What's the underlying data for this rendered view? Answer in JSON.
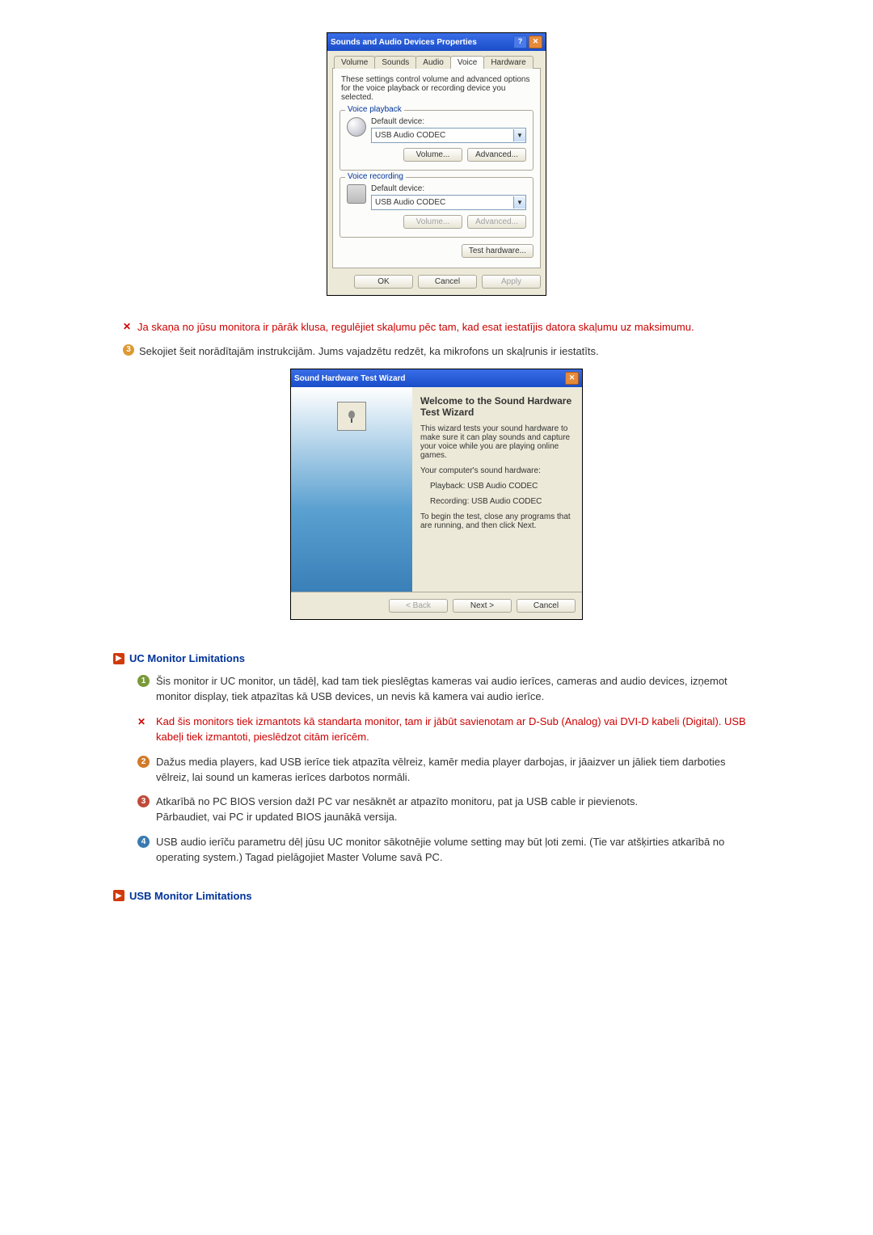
{
  "dialog1": {
    "title": "Sounds and Audio Devices Properties",
    "tabs": [
      "Volume",
      "Sounds",
      "Audio",
      "Voice",
      "Hardware"
    ],
    "active_tab": "Voice",
    "description": "These settings control volume and advanced options for the voice playback or recording device you selected.",
    "playback": {
      "group_label": "Voice playback",
      "label": "Default device:",
      "value": "USB Audio CODEC",
      "volume_btn": "Volume...",
      "advanced_btn": "Advanced..."
    },
    "recording": {
      "group_label": "Voice recording",
      "label": "Default device:",
      "value": "USB Audio CODEC",
      "volume_btn": "Volume...",
      "advanced_btn": "Advanced..."
    },
    "test_btn": "Test hardware...",
    "ok": "OK",
    "cancel": "Cancel",
    "apply": "Apply"
  },
  "note_x": "Ja skaņa no jūsu monitora ir pārāk klusa, regulējiet skaļumu pēc tam, kad esat iestatījis datora skaļumu uz maksimumu.",
  "note_3": "Sekojiet šeit norādītajām instrukcijām. Jums vajadzētu redzēt, ka mikrofons un skaļrunis ir iestatīts.",
  "wizard": {
    "title_bar": "Sound Hardware Test Wizard",
    "heading": "Welcome to the Sound Hardware Test Wizard",
    "p1": "This wizard tests your sound hardware to make sure it can play sounds and capture your voice while you are playing online games.",
    "p2": "Your computer's sound hardware:",
    "playback": "Playback:  USB Audio CODEC",
    "recording": "Recording:  USB Audio CODEC",
    "p3": "To begin the test, close any programs that are running, and then click Next.",
    "back": "< Back",
    "next": "Next >",
    "cancel": "Cancel"
  },
  "section_uc": "UC Monitor Limitations",
  "uc_items": {
    "i1": "Šis monitor ir UC monitor, un tādēļ, kad tam tiek pieslēgtas kameras vai audio ierīces, cameras and audio devices, izņemot monitor display, tiek atpazītas kā USB devices, un nevis kā kamera vai audio ierīce.",
    "ix": "Kad šis monitors tiek izmantots kā standarta monitor, tam ir jābūt savienotam ar D-Sub (Analog) vai DVI-D kabeli (Digital). USB kabeļi tiek izmantoti, pieslēdzot citām ierīcēm.",
    "i2": "Dažus media players, kad USB ierīce tiek atpazīta vēlreiz, kamēr media player darbojas, ir jāaizver un jāliek tiem darboties vēlreiz, lai sound un kameras ierīces darbotos normāli.",
    "i3a": "Atkarībā no PC BIOS version dažI PC var nesāknēt ar atpazīto monitoru, pat ja USB cable ir pievienots.",
    "i3b": "Pārbaudiet, vai PC ir updated BIOS jaunākā versija.",
    "i4": "USB audio ierīču parametru dēļ jūsu UC monitor sākotnējie volume setting may būt ļoti zemi. (Tie var atšķirties atkarībā no operating system.) Tagad pielāgojiet Master Volume savā PC."
  },
  "section_usb": "USB Monitor Limitations"
}
